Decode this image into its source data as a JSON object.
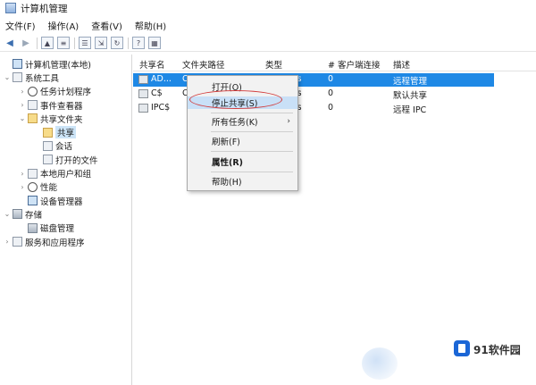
{
  "window": {
    "title": "计算机管理"
  },
  "menubar": {
    "items": [
      "文件(F)",
      "操作(A)",
      "查看(V)",
      "帮助(H)"
    ]
  },
  "toolbar": {
    "icons": [
      "back-arrow-icon",
      "forward-arrow-icon",
      "up-folder-icon",
      "properties-icon",
      "list-icon",
      "export-icon",
      "refresh-icon",
      "help-icon",
      "details-icon"
    ]
  },
  "tree": {
    "items": [
      {
        "label": "计算机管理(本地)",
        "expander": "",
        "icon": "computer-icon"
      },
      {
        "label": "系统工具",
        "expander": "⌄",
        "icon": "tools-icon"
      },
      {
        "label": "任务计划程序",
        "expander": "›",
        "icon": "clock-icon"
      },
      {
        "label": "事件查看器",
        "expander": "›",
        "icon": "event-viewer-icon"
      },
      {
        "label": "共享文件夹",
        "expander": "⌄",
        "icon": "shared-folder-icon"
      },
      {
        "label": "共享",
        "expander": "",
        "icon": "share-icon"
      },
      {
        "label": "会话",
        "expander": "",
        "icon": "session-icon"
      },
      {
        "label": "打开的文件",
        "expander": "",
        "icon": "open-files-icon"
      },
      {
        "label": "本地用户和组",
        "expander": "›",
        "icon": "users-icon"
      },
      {
        "label": "性能",
        "expander": "›",
        "icon": "performance-icon"
      },
      {
        "label": "设备管理器",
        "expander": "",
        "icon": "device-manager-icon"
      },
      {
        "label": "存储",
        "expander": "⌄",
        "icon": "storage-icon"
      },
      {
        "label": "磁盘管理",
        "expander": "",
        "icon": "disk-icon"
      },
      {
        "label": "服务和应用程序",
        "expander": "›",
        "icon": "services-icon"
      }
    ]
  },
  "list": {
    "columns": [
      "共享名",
      "文件夹路径",
      "类型",
      "# 客户端连接",
      "描述"
    ],
    "rows": [
      {
        "name": "AD...",
        "path": "C",
        "type": "vs",
        "clients": "0",
        "desc": "远程管理"
      },
      {
        "name": "C$",
        "path": "C",
        "type": "vs",
        "clients": "0",
        "desc": "默认共享"
      },
      {
        "name": "IPC$",
        "path": "",
        "type": "vs",
        "clients": "0",
        "desc": "远程 IPC"
      }
    ]
  },
  "context_menu": {
    "items": [
      {
        "label": "打开(O)"
      },
      {
        "label": "停止共享(S)"
      },
      {
        "label": "所有任务(K)",
        "arrow": "›"
      },
      {
        "label": "刷新(F)"
      },
      {
        "label": "属性(R)"
      },
      {
        "label": "帮助(H)"
      }
    ]
  },
  "watermark": {
    "brand": "91软件园"
  },
  "colors": {
    "selection": "#1e88e5",
    "highlight": "#c9e0f7",
    "annotation": "#d23c3c"
  }
}
